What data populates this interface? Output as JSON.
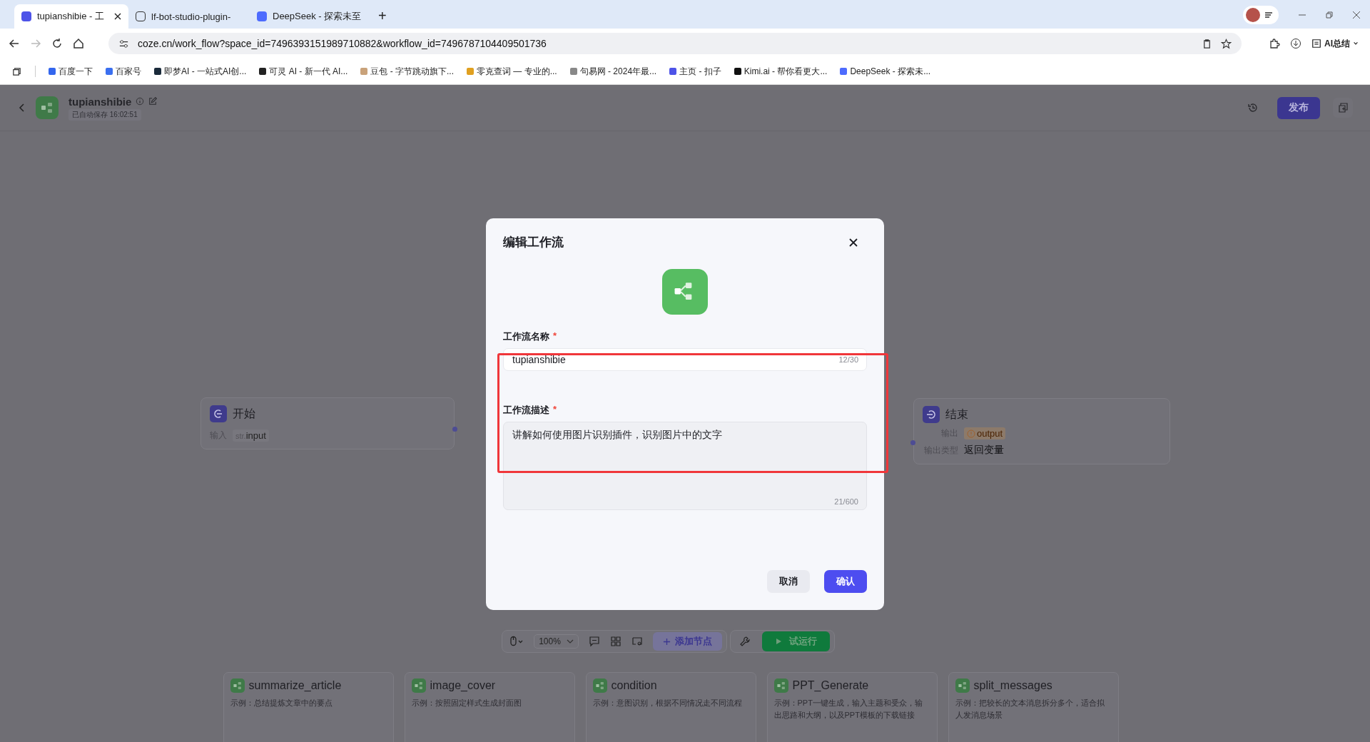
{
  "browser": {
    "tabs": [
      {
        "title": "tupianshibie - 工",
        "selected": true
      },
      {
        "title": "lf-bot-studio-plugin-",
        "selected": false
      },
      {
        "title": "DeepSeek - 探索未至",
        "selected": false
      }
    ],
    "new_tab": "+",
    "url": "coze.cn/work_flow?space_id=7496393151989710882&workflow_id=7496787104409501736",
    "ai_button": "AI总结",
    "bookmarks": [
      {
        "title": "百度一下",
        "color": "#3366ee"
      },
      {
        "title": "百家号",
        "color": "#3a6ff0"
      },
      {
        "title": "即梦AI - 一站式AI创...",
        "color": "#1a2a3a"
      },
      {
        "title": "可灵 AI - 新一代 AI...",
        "color": "#222222"
      },
      {
        "title": "豆包 - 字节跳动旗下...",
        "color": "#c9a27a"
      },
      {
        "title": "零克查词 — 专业的...",
        "color": "#e0a020"
      },
      {
        "title": "句易网 - 2024年最...",
        "color": "#888888"
      },
      {
        "title": "主页 - 扣子",
        "color": "#4d53e8"
      },
      {
        "title": "Kimi.ai - 帮你看更大...",
        "color": "#111111"
      },
      {
        "title": "DeepSeek - 探索未...",
        "color": "#4d6bfe"
      }
    ]
  },
  "header": {
    "title": "tupianshibie",
    "saved_status": "已自动保存 16:02:51",
    "publish_button": "发布"
  },
  "nodes": [
    {
      "kind": "start",
      "title": "开始",
      "rows": [
        {
          "label": "输入",
          "type": "str.",
          "value": "input",
          "kind": "param"
        }
      ]
    },
    {
      "kind": "end",
      "title": "结束",
      "rows": [
        {
          "label": "输出",
          "value": "output",
          "kind": "variable"
        },
        {
          "label": "输出类型",
          "value": "返回变量",
          "kind": "text"
        }
      ]
    }
  ],
  "toolbar": {
    "zoom": "100%",
    "add_node": "添加节点",
    "test_run": "试运行"
  },
  "templates": [
    {
      "name": "summarize_article",
      "description": "示例：总结提炼文章中的要点"
    },
    {
      "name": "image_cover",
      "description": "示例：按照固定样式生成封面图"
    },
    {
      "name": "condition",
      "description": "示例：意图识别，根据不同情况走不同流程"
    },
    {
      "name": "PPT_Generate",
      "description": "示例：PPT一键生成，输入主题和受众，输出思路和大纲，以及PPT模板的下载链接"
    },
    {
      "name": "split_messages",
      "description": "示例：把较长的文本消息拆分多个，适合拟人发消息场景"
    }
  ],
  "dialog": {
    "title": "编辑工作流",
    "name_field": {
      "label": "工作流名称",
      "required": true,
      "required_mark": "*",
      "value": "tupianshibie",
      "counter": "12/30"
    },
    "description_field": {
      "label": "工作流描述",
      "required": true,
      "required_mark": "*",
      "value": "讲解如何使用图片识别插件，识别图片中的文字",
      "counter": "21/600"
    },
    "cancel_button": "取消",
    "confirm_button": "确认"
  }
}
